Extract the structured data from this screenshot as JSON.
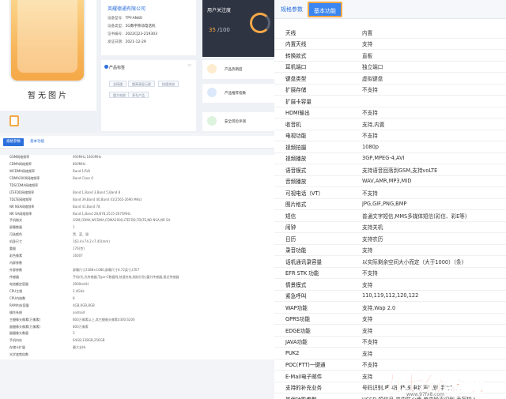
{
  "left": {
    "phone_caption": "暂无图片",
    "company": "英耀德通有限公司",
    "info": [
      {
        "label": "设备型号:",
        "value": "TPY-AN40"
      },
      {
        "label": "设备类型:",
        "value": "5G数字移动电话机"
      },
      {
        "label": "证书编号:",
        "value": "2022CJ23-219303"
      },
      {
        "label": "发证日期:",
        "value": "2021-12-29"
      }
    ],
    "score": {
      "title": "用户关注度",
      "value": "35",
      "total": "/100"
    },
    "tags_card": {
      "title": "产品标签",
      "tags": [
        "全网通",
        "超高清显示屏",
        "快速充电",
        "超大电池",
        "多孔产品"
      ]
    },
    "metrics": [
      "产品热销度",
      "产品推荐指数",
      "安全风险评测"
    ],
    "tabs": {
      "active": "规格参数",
      "other": "基本功能"
    },
    "specs": [
      {
        "k": "GSM网络频率",
        "v": "900MHz,1800MHz"
      },
      {
        "k": "CDMA网络频率",
        "v": "800MHz"
      },
      {
        "k": "WCDMA网络频率",
        "v": "Band 1/5/8"
      },
      {
        "k": "CDMA2000网络频率",
        "v": "Band Class 0"
      },
      {
        "k": "TDSCDMA网络频率",
        "v": ""
      },
      {
        "k": "LTEFDD网络频率",
        "v": "Band 1,Band 3,Band 5,Band 8"
      },
      {
        "k": "TDLTE网络频率",
        "v": "Band 39,Band 40,Band 41(2565-2690 MHz)"
      },
      {
        "k": "NR NSA网络频率",
        "v": "Band 41,Band 78"
      },
      {
        "k": "NR SA网络频率",
        "v": "Band 1,Band 28,N78,2515-2675MHz"
      },
      {
        "k": "手机制式",
        "v": "GSM,CDMA,WCDMA,CDMA2000,LTEFDD,TDLTE,NR NSA,NR SA"
      },
      {
        "k": "屏幕数量",
        "v": "1"
      },
      {
        "k": "可选颜色",
        "v": "黑、蓝、银"
      },
      {
        "k": "机身尺寸",
        "v": "163.4×74.2×7.45(mm)"
      },
      {
        "k": "重量",
        "v": "176(克)"
      },
      {
        "k": "彩色像素",
        "v": "16007"
      },
      {
        "k": "内屏参数",
        "v": ""
      },
      {
        "k": "外屏参数",
        "v": "屏幕尺寸2388×1080,屏幕尺寸6.72英寸,LTE7"
      },
      {
        "k": "传感器",
        "v": "手机/光,光传感器,Type-C数据线,快速充电,指纹识别,重力传感器,接近传感器"
      },
      {
        "k": "电池额定容量",
        "v": "3900mAH"
      },
      {
        "k": "CPU主频",
        "v": "2.4GHz"
      },
      {
        "k": "CPU内核数",
        "v": "8"
      },
      {
        "k": "RAM内存容量",
        "v": "4GB,6GB,8GB"
      },
      {
        "k": "操作系统",
        "v": "android"
      },
      {
        "k": "主摄像头像素(万像素)",
        "v": "800万像素以上,其它摄像头像素4300,6200"
      },
      {
        "k": "副摄像头像素(万像素)",
        "v": "800万像素"
      },
      {
        "k": "副摄像头数量",
        "v": "3"
      },
      {
        "k": "手机内存",
        "v": "64GB,128GB,256GB"
      },
      {
        "k": "存储卡扩展",
        "v": "最大支持"
      },
      {
        "k": "光学变焦倍数",
        "v": ""
      }
    ]
  },
  "right": {
    "tabs": {
      "first": "规格参数",
      "active": "基本功能"
    },
    "rows": [
      {
        "k": "天线",
        "v": "内置"
      },
      {
        "k": "内置天线",
        "v": "支持"
      },
      {
        "k": "转换款式",
        "v": "直板"
      },
      {
        "k": "耳机端口",
        "v": "独立端口"
      },
      {
        "k": "键盘类型",
        "v": "虚拟键盘"
      },
      {
        "k": "扩展存储",
        "v": "不支持"
      },
      {
        "k": "扩展卡容量",
        "v": ""
      },
      {
        "k": "HDMI输出",
        "v": "不支持"
      },
      {
        "k": "收音机",
        "v": "支持,内置"
      },
      {
        "k": "电视功能",
        "v": "不支持"
      },
      {
        "k": "视频拍摄",
        "v": "1080p"
      },
      {
        "k": "视频播放",
        "v": "3GP,MPEG-4,AVI"
      },
      {
        "k": "语音模式",
        "v": "支持语音回落到GSM,支持voLTE"
      },
      {
        "k": "音频播放",
        "v": "WAV,AMR,MP3,MID"
      },
      {
        "k": "可视电话（VT）",
        "v": "不支持"
      },
      {
        "k": "图片格式",
        "v": "JPG,GIF,PNG,BMP"
      },
      {
        "k": "短信",
        "v": "普通文字短信,MMS多媒体短信(彩信、彩E等)"
      },
      {
        "k": "闹钟",
        "v": "支持关机"
      },
      {
        "k": "日历",
        "v": "支持农历"
      },
      {
        "k": "录音功能",
        "v": "支持"
      },
      {
        "k": "话机通讯录容量",
        "v": "以实际剩余空间大小而定（大于1000）（条)"
      },
      {
        "k": "EFR STK 功能",
        "v": "不支持"
      },
      {
        "k": "情景模式",
        "v": "支持"
      },
      {
        "k": "紧急呼叫",
        "v": "110,119,112,120,122"
      },
      {
        "k": "WAP功能",
        "v": "支持,Wap 2.0"
      },
      {
        "k": "GPRS功能",
        "v": "支持"
      },
      {
        "k": "EDGE功能",
        "v": "支持"
      },
      {
        "k": "JAVA功能",
        "v": "不支持"
      },
      {
        "k": "PUK2",
        "v": "支持"
      },
      {
        "k": "POC(PTT)一键通",
        "v": "不支持"
      },
      {
        "k": "E-Mail电子邮件",
        "v": "支持"
      },
      {
        "k": "支持的补充业务",
        "v": "号码识别,呼叫转移,来电铃声识别,手写输入"
      },
      {
        "k": "其他功能参数",
        "v": "USSD,短信息,来电防火墙,单电铃声识别,手写输入"
      }
    ]
  },
  "watermark": {
    "text": "九七分享吧",
    "url": "www.97fx8.com"
  }
}
